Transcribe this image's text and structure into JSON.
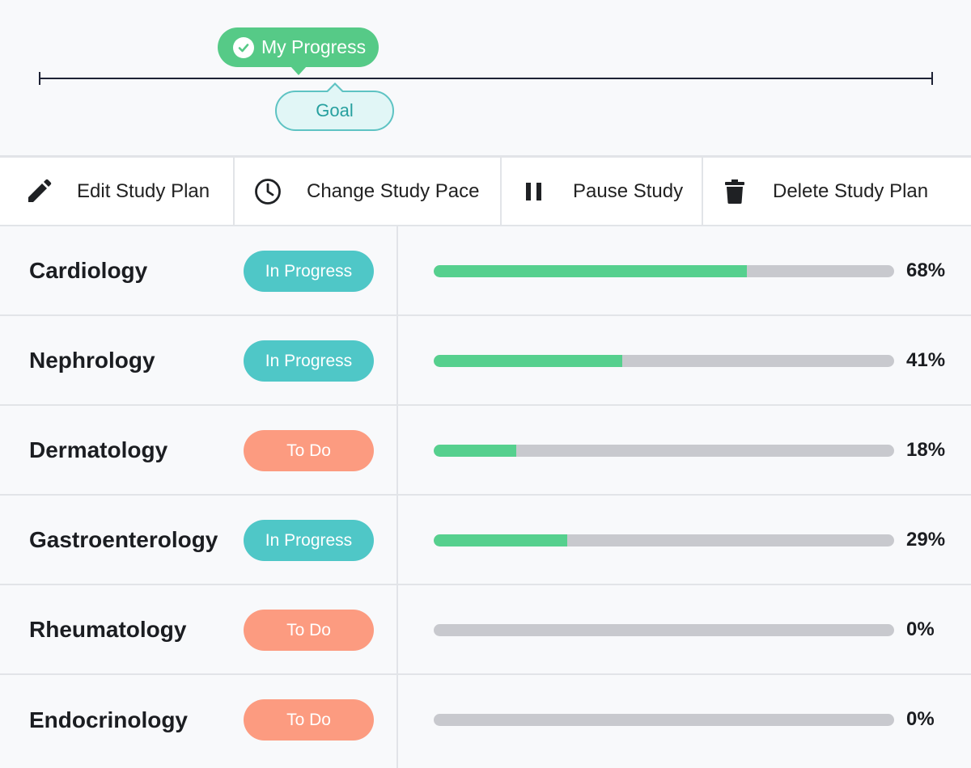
{
  "timeline": {
    "progress_label": "My Progress",
    "goal_label": "Goal"
  },
  "toolbar": {
    "edit_label": "Edit Study Plan",
    "pace_label": "Change Study Pace",
    "pause_label": "Pause Study",
    "delete_label": "Delete Study Plan"
  },
  "subjects": [
    {
      "name": "Cardiology",
      "status": "In Progress",
      "progress": 68,
      "progress_label": "68%"
    },
    {
      "name": "Nephrology",
      "status": "In Progress",
      "progress": 41,
      "progress_label": "41%"
    },
    {
      "name": "Dermatology",
      "status": "To Do",
      "progress": 18,
      "progress_label": "18%"
    },
    {
      "name": "Gastroenterology",
      "status": "In Progress",
      "progress": 29,
      "progress_label": "29%"
    },
    {
      "name": "Rheumatology",
      "status": "To Do",
      "progress": 0,
      "progress_label": "0%"
    },
    {
      "name": "Endocrinology",
      "status": "To Do",
      "progress": 0,
      "progress_label": "0%"
    }
  ],
  "colors": {
    "progress_green": "#56d08e",
    "in_progress_badge": "#4fc7c7",
    "todo_badge": "#fc9b80",
    "bar_track": "#c8c9ce",
    "goal_teal": "#5ec3c3"
  },
  "icons": {
    "progress_tag": "check-circle-icon",
    "edit": "pencil-icon",
    "pace": "clock-icon",
    "pause": "pause-icon",
    "delete": "trash-icon"
  }
}
